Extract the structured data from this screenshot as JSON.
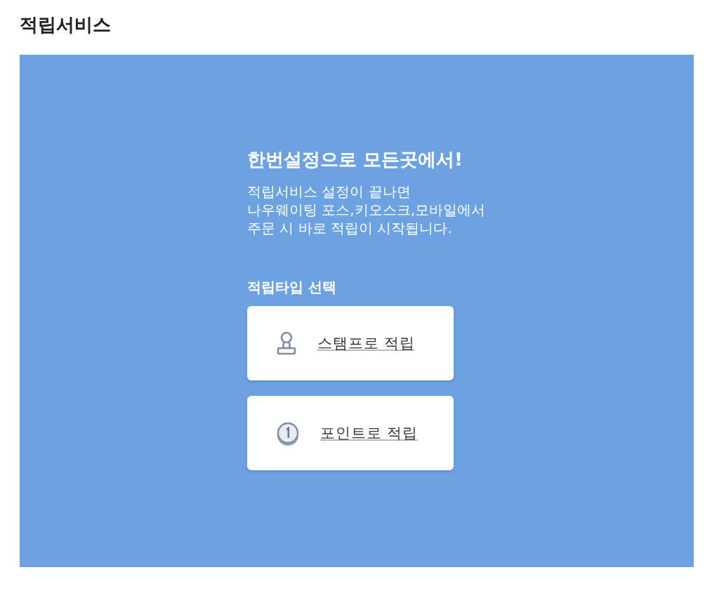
{
  "page_title": "적립서비스",
  "panel": {
    "heading": "한번설정으로 모든곳에서!",
    "description": "적립서비스 설정이 끝나면\n나우웨이팅 포스,키오스크,모바일에서\n주문 시 바로 적립이 시작됩니다.",
    "type_label": "적립타입 선택",
    "options": [
      {
        "kind": "stamp",
        "label": "스탬프로 적립"
      },
      {
        "kind": "point",
        "label": "포인트로 적립"
      }
    ]
  }
}
